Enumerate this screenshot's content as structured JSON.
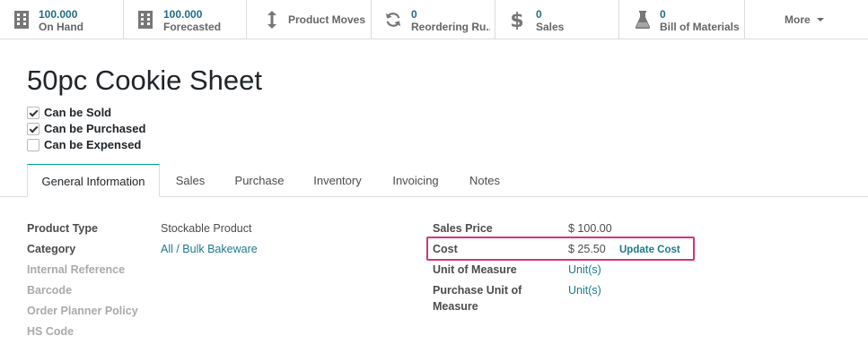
{
  "smart_buttons": {
    "on_hand": {
      "value": "100.000",
      "label": "On Hand",
      "icon": "building-icon"
    },
    "forecasted": {
      "value": "100.000",
      "label": "Forecasted",
      "icon": "building-icon"
    },
    "product_moves": {
      "label": "Product Moves",
      "icon": "up-down-arrow-icon"
    },
    "reordering": {
      "value": "0",
      "label": "Reordering Ru...",
      "icon": "refresh-icon"
    },
    "sales": {
      "value": "0",
      "label": "Sales",
      "icon": "dollar-icon"
    },
    "bom": {
      "value": "0",
      "label": "Bill of Materials",
      "icon": "flask-icon"
    },
    "more": {
      "label": "More"
    }
  },
  "product": {
    "name": "50pc Cookie Sheet",
    "checkboxes": [
      {
        "label": "Can be Sold",
        "checked": true
      },
      {
        "label": "Can be Purchased",
        "checked": true
      },
      {
        "label": "Can be Expensed",
        "checked": false
      }
    ]
  },
  "tabs": [
    "General Information",
    "Sales",
    "Purchase",
    "Inventory",
    "Invoicing",
    "Notes"
  ],
  "general": {
    "left": [
      {
        "label": "Product Type",
        "value": "Stockable Product"
      },
      {
        "label": "Category",
        "value": "All / Bulk Bakeware"
      },
      {
        "label": "Internal Reference",
        "value": ""
      },
      {
        "label": "Barcode",
        "value": ""
      },
      {
        "label": "Order Planner Policy",
        "value": ""
      },
      {
        "label": "HS Code",
        "value": ""
      }
    ],
    "right": {
      "sales_price": {
        "label": "Sales Price",
        "value": "$ 100.00"
      },
      "cost": {
        "label": "Cost",
        "value": "$ 25.50",
        "action": "Update Cost"
      },
      "uom": {
        "label": "Unit of Measure",
        "value": "Unit(s)"
      },
      "purchase_uom": {
        "label_line1": "Purchase Unit of",
        "label_line2": "Measure",
        "value": "Unit(s)"
      }
    }
  },
  "colors": {
    "accent": "#1b7a8c",
    "highlight": "#d6337c",
    "active_tab": "#00a09d"
  }
}
